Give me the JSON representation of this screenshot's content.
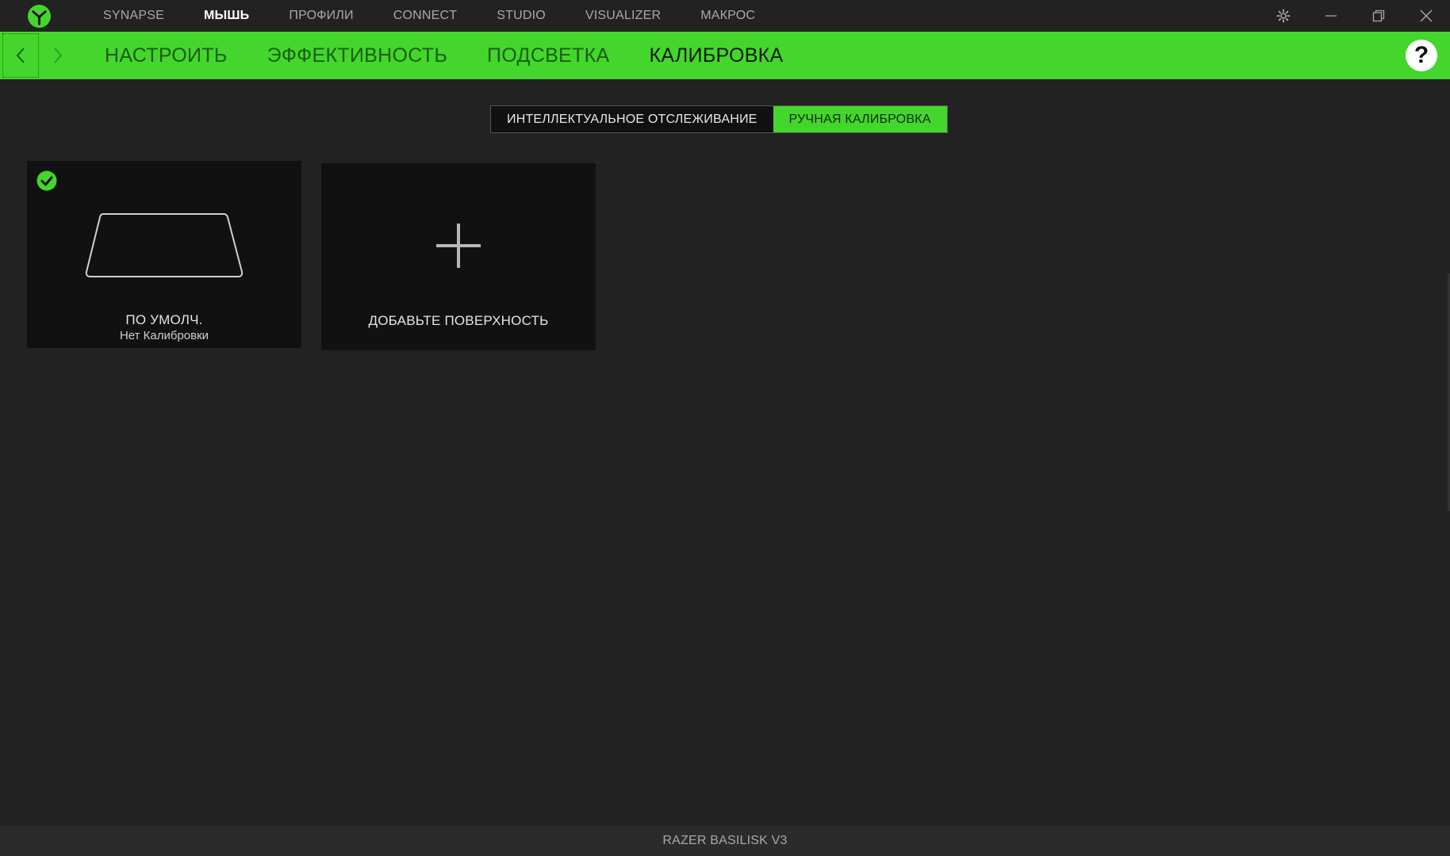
{
  "app": {
    "brand_color": "#44d62c",
    "logo_icon": "razer-logo-icon"
  },
  "top_nav": {
    "items": [
      {
        "label": "SYNAPSE",
        "active": false
      },
      {
        "label": "МЫШЬ",
        "active": true
      },
      {
        "label": "ПРОФИЛИ",
        "active": false
      },
      {
        "label": "CONNECT",
        "active": false
      },
      {
        "label": "STUDIO",
        "active": false
      },
      {
        "label": "VISUALIZER",
        "active": false
      },
      {
        "label": "МАКРОС",
        "active": false
      }
    ]
  },
  "window_controls": [
    "gear-icon",
    "minimize-icon",
    "restore-icon",
    "close-icon"
  ],
  "sub_nav": {
    "tabs": [
      {
        "label": "НАСТРОИТЬ",
        "active": false
      },
      {
        "label": "ЭФФЕКТИВНОСТЬ",
        "active": false
      },
      {
        "label": "ПОДСВЕТКА",
        "active": false
      },
      {
        "label": "КАЛИБРОВКА",
        "active": true
      }
    ],
    "help_label": "?"
  },
  "calibration_mode": {
    "options": [
      {
        "label": "ИНТЕЛЛЕКТУАЛЬНОЕ ОТСЛЕЖИВАНИЕ",
        "active": false
      },
      {
        "label": "РУЧНАЯ КАЛИБРОВКА",
        "active": true
      }
    ]
  },
  "surfaces": {
    "default": {
      "title": "ПО УМОЛЧ.",
      "subtitle": "Нет Калибровки",
      "selected": true
    },
    "add": {
      "title": "ДОБАВЬТЕ ПОВЕРХНОСТЬ"
    }
  },
  "footer": {
    "device_name": "RAZER BASILISK V3"
  }
}
